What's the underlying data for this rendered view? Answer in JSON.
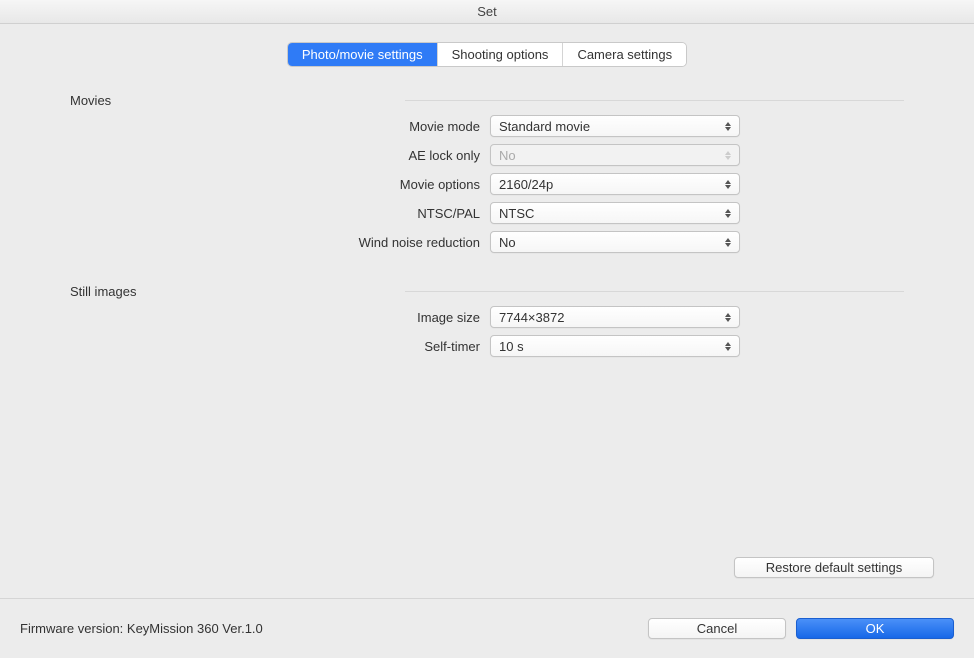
{
  "window": {
    "title": "Set"
  },
  "tabs": {
    "photo_movie": "Photo/movie settings",
    "shooting_options": "Shooting options",
    "camera_settings": "Camera settings"
  },
  "sections": {
    "movies": {
      "title": "Movies",
      "movie_mode": {
        "label": "Movie mode",
        "value": "Standard movie"
      },
      "ae_lock_only": {
        "label": "AE lock only",
        "value": "No"
      },
      "movie_options": {
        "label": "Movie options",
        "value": "2160/24p"
      },
      "ntsc_pal": {
        "label": "NTSC/PAL",
        "value": "NTSC"
      },
      "wind_noise": {
        "label": "Wind noise reduction",
        "value": "No"
      }
    },
    "still_images": {
      "title": "Still images",
      "image_size": {
        "label": "Image size",
        "value": "7744×3872"
      },
      "self_timer": {
        "label": "Self-timer",
        "value": "10 s"
      }
    }
  },
  "buttons": {
    "restore": "Restore default settings",
    "cancel": "Cancel",
    "ok": "OK"
  },
  "footer": {
    "firmware": "Firmware version: KeyMission 360 Ver.1.0"
  }
}
